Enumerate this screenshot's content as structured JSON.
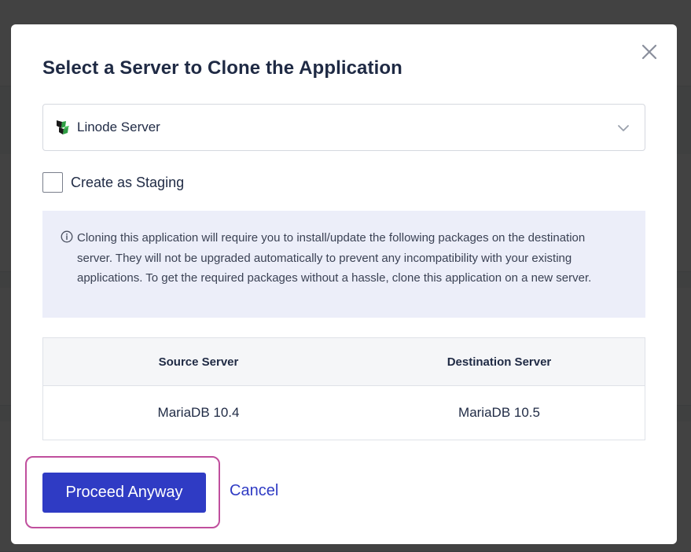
{
  "modal": {
    "title": "Select a Server to Clone the Application",
    "close_icon": "close-icon"
  },
  "server_select": {
    "selected": "Linode Server",
    "icon": "linode-server-icon",
    "chevron_icon": "chevron-down-icon"
  },
  "staging": {
    "label": "Create as Staging",
    "checked": false
  },
  "info": {
    "icon": "info-icon",
    "text": "Cloning this application will require you to install/update the following packages on the destination server. They will not be upgraded automatically to prevent any incompatibility with your existing applications. To get the required packages without a hassle, clone this application on a new server."
  },
  "packages_table": {
    "headers": [
      "Source Server",
      "Destination Server"
    ],
    "rows": [
      [
        "MariaDB 10.4",
        "MariaDB 10.5"
      ]
    ]
  },
  "actions": {
    "proceed_label": "Proceed Anyway",
    "cancel_label": "Cancel"
  },
  "colors": {
    "primary": "#2f3bc4",
    "highlight": "#c04f9d",
    "info_bg": "#eceef9"
  }
}
